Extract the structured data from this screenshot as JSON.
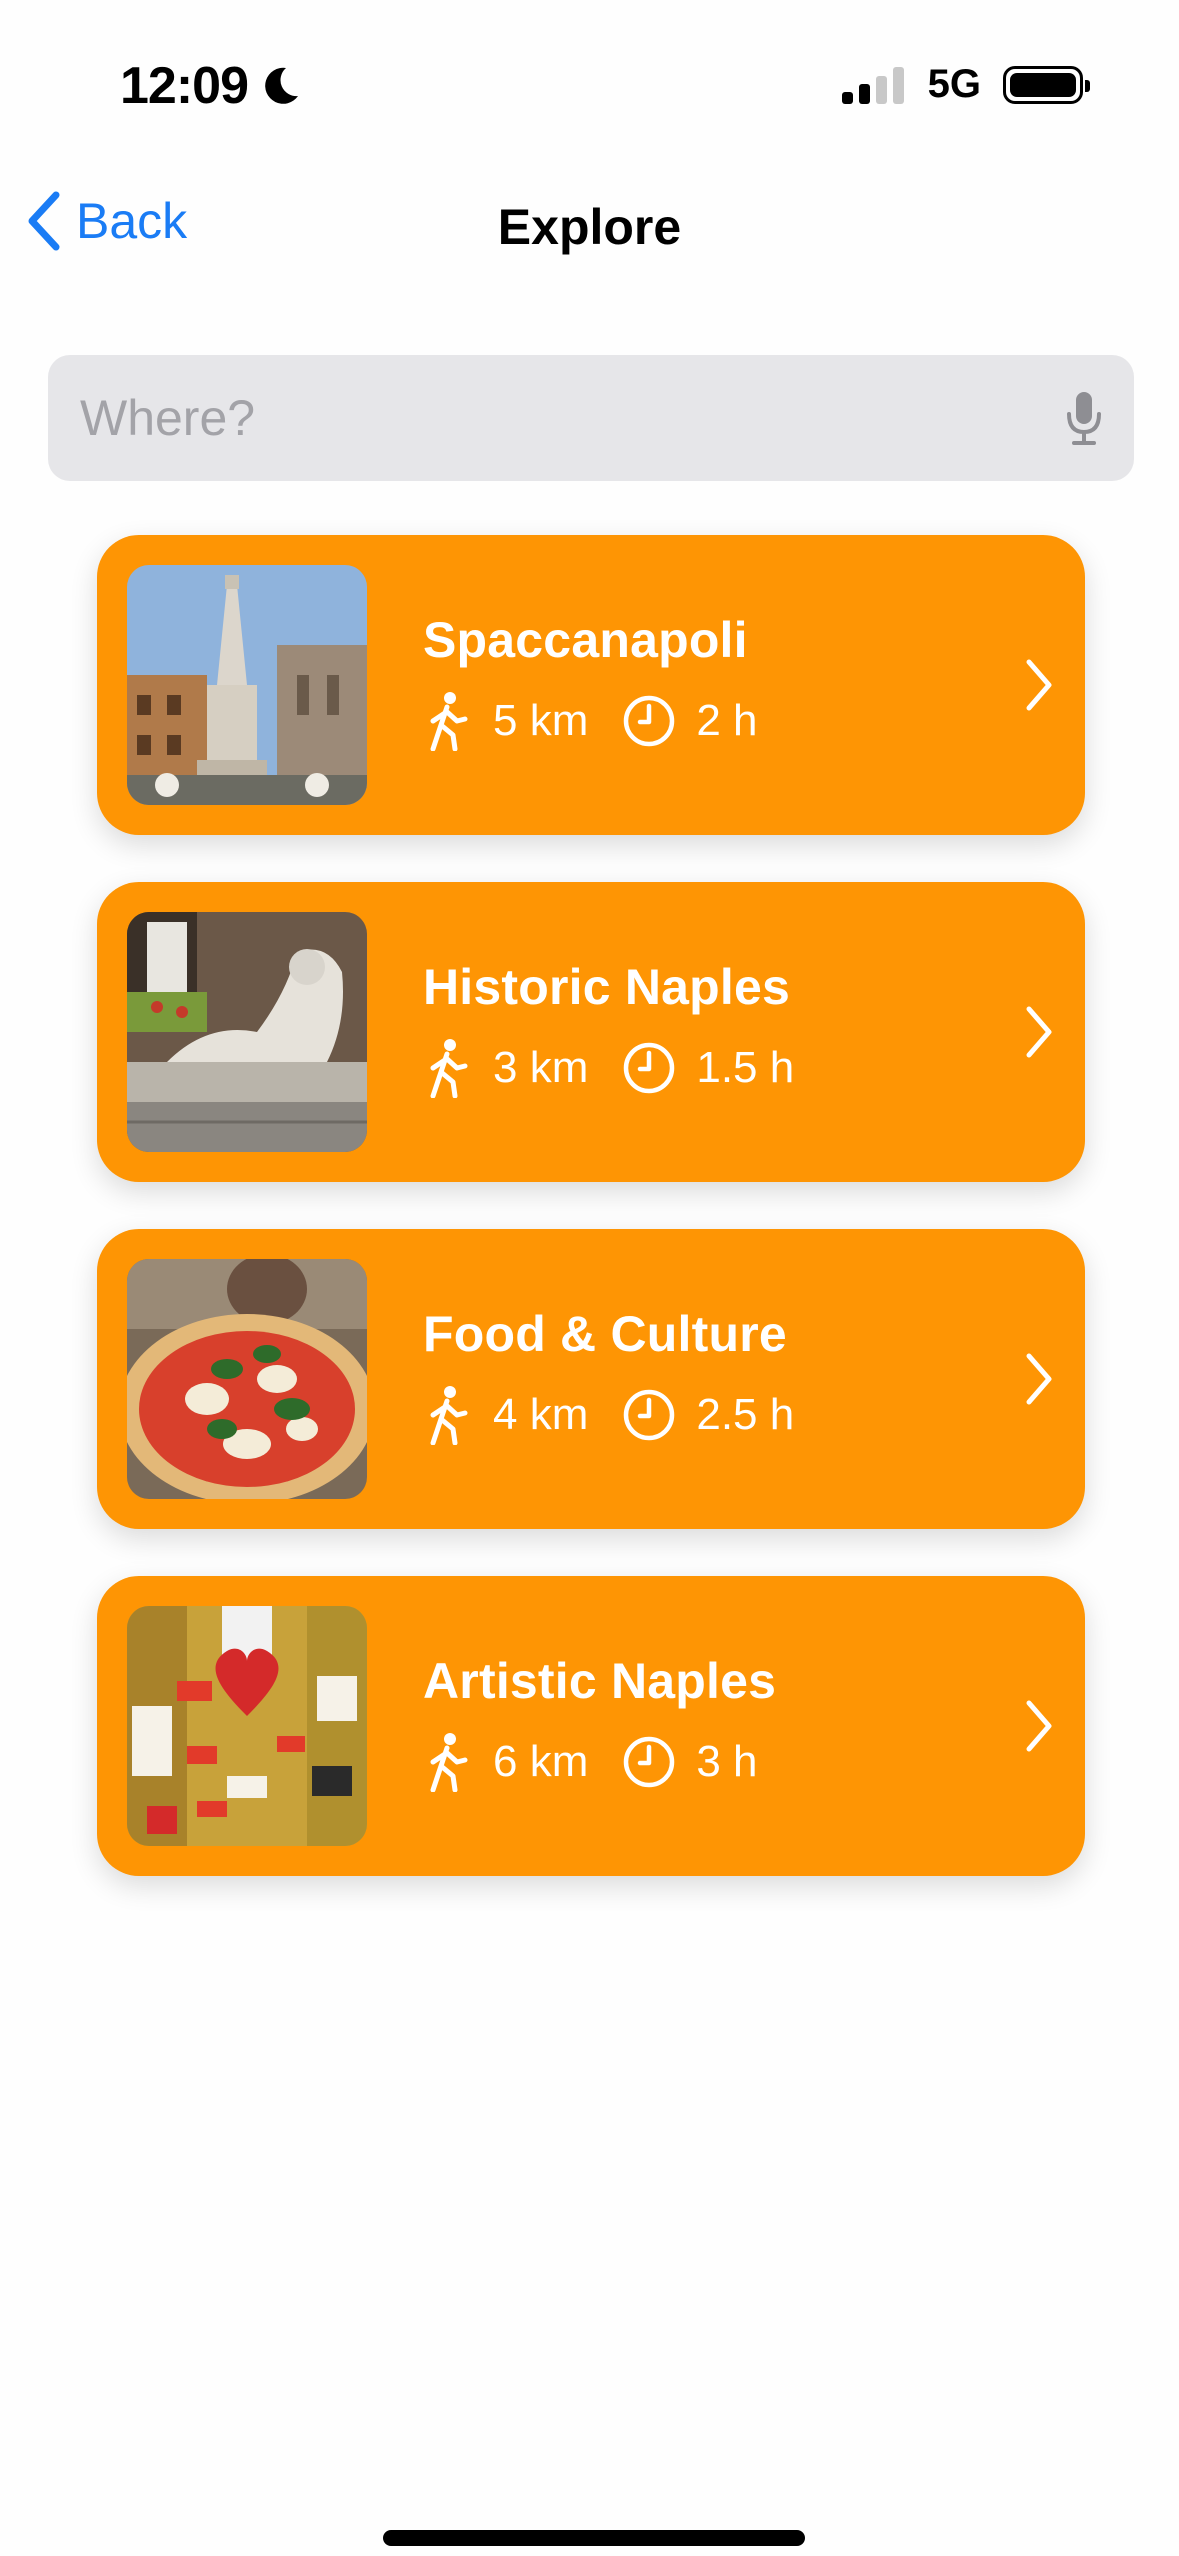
{
  "status_bar": {
    "time": "12:09",
    "network": "5G",
    "icons": [
      "moon-icon",
      "signal-icon",
      "battery-icon"
    ]
  },
  "nav": {
    "back_label": "Back",
    "title": "Explore"
  },
  "search": {
    "placeholder": "Where?",
    "value": ""
  },
  "tours": [
    {
      "title": "Spaccanapoli",
      "distance": "5 km",
      "duration": "2 h"
    },
    {
      "title": "Historic Naples",
      "distance": "3 km",
      "duration": "1.5 h"
    },
    {
      "title": "Food & Culture",
      "distance": "4 km",
      "duration": "2.5 h"
    },
    {
      "title": "Artistic Naples",
      "distance": "6 km",
      "duration": "3 h"
    }
  ],
  "colors": {
    "accent": "#fe9504",
    "link": "#1a7cf5",
    "search_bg": "#e6e6e9"
  }
}
